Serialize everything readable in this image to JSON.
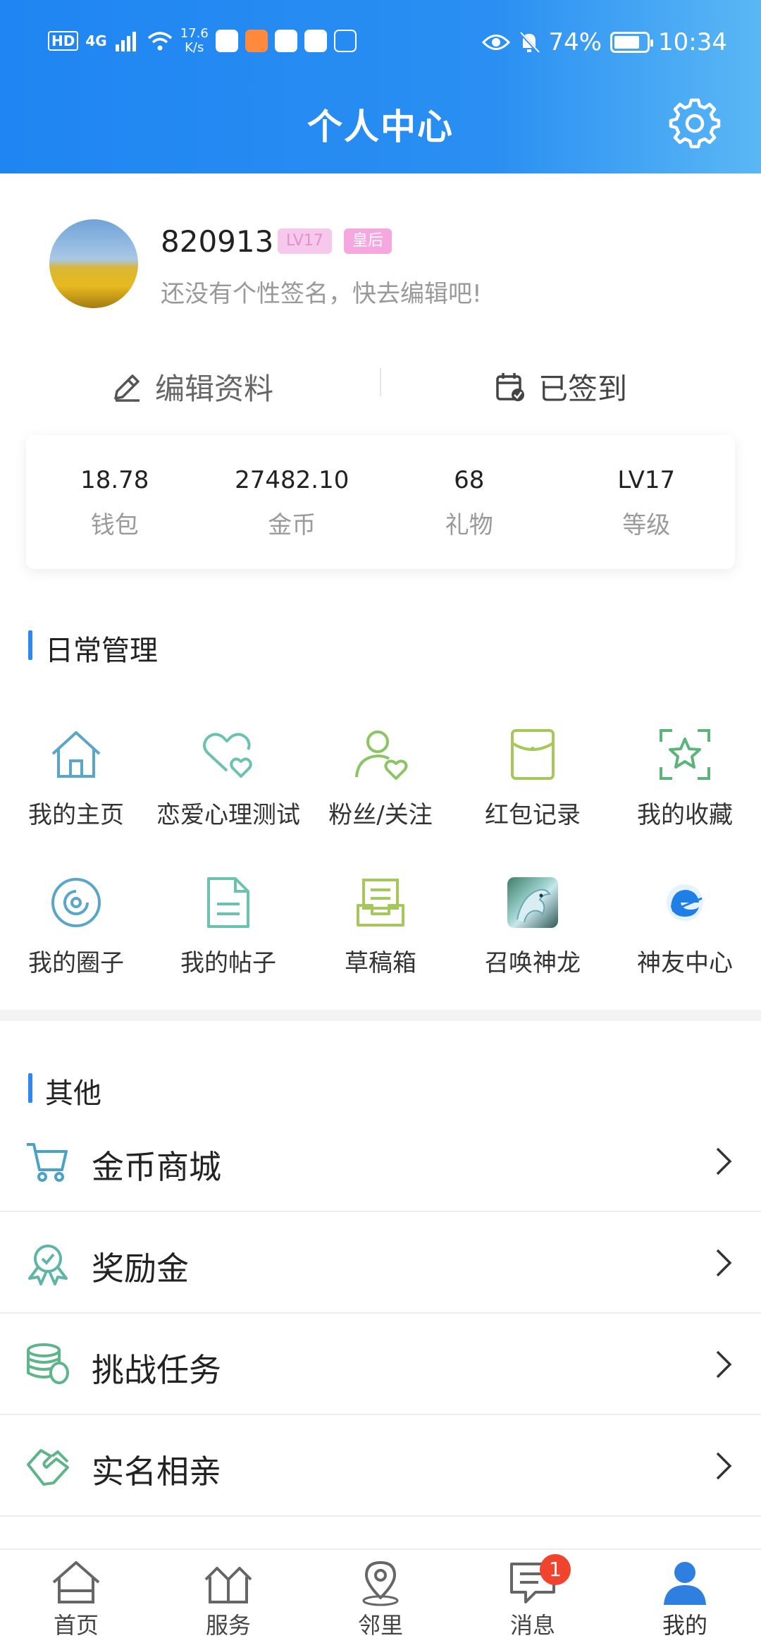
{
  "status_bar": {
    "hd_badge": "HD",
    "network": "4G",
    "speed_value": "17.6",
    "speed_unit": "K/s",
    "battery": "74%",
    "time": "10:34"
  },
  "header": {
    "title": "个人中心"
  },
  "profile": {
    "username": "820913",
    "level_tag": "LV17",
    "title_tag": "皇后",
    "signature": "还没有个性签名，快去编辑吧!",
    "edit_label": "编辑资料",
    "signed_label": "已签到"
  },
  "stats": [
    {
      "value": "18.78",
      "label": "钱包"
    },
    {
      "value": "27482.10",
      "label": "金币"
    },
    {
      "value": "68",
      "label": "礼物"
    },
    {
      "value": "LV17",
      "label": "等级"
    }
  ],
  "daily": {
    "title": "日常管理",
    "items": [
      {
        "label": "我的主页",
        "icon": "home-icon"
      },
      {
        "label": "恋爱心理测试",
        "icon": "hearts-icon"
      },
      {
        "label": "粉丝/关注",
        "icon": "user-heart-icon"
      },
      {
        "label": "红包记录",
        "icon": "red-envelope-icon"
      },
      {
        "label": "我的收藏",
        "icon": "star-icon"
      },
      {
        "label": "我的圈子",
        "icon": "circle-icon"
      },
      {
        "label": "我的帖子",
        "icon": "document-icon"
      },
      {
        "label": "草稿箱",
        "icon": "draft-box-icon"
      },
      {
        "label": "召唤神龙",
        "icon": "dragon-icon"
      },
      {
        "label": "神友中心",
        "icon": "friend-center-icon"
      }
    ]
  },
  "other": {
    "title": "其他",
    "items": [
      {
        "label": "金币商城",
        "icon": "cart-icon"
      },
      {
        "label": "奖励金",
        "icon": "reward-icon"
      },
      {
        "label": "挑战任务",
        "icon": "coins-icon"
      },
      {
        "label": "实名相亲",
        "icon": "handshake-icon"
      }
    ]
  },
  "tabbar": {
    "items": [
      {
        "label": "首页",
        "icon": "home-icon"
      },
      {
        "label": "服务",
        "icon": "service-icon"
      },
      {
        "label": "邻里",
        "icon": "location-icon"
      },
      {
        "label": "消息",
        "icon": "message-icon",
        "badge": "1"
      },
      {
        "label": "我的",
        "icon": "profile-icon"
      }
    ],
    "active_color": "#2f7fe0"
  },
  "colors": {
    "header_start": "#1f85f2",
    "header_end": "#5ab7f5",
    "accent": "#2f88ee"
  }
}
